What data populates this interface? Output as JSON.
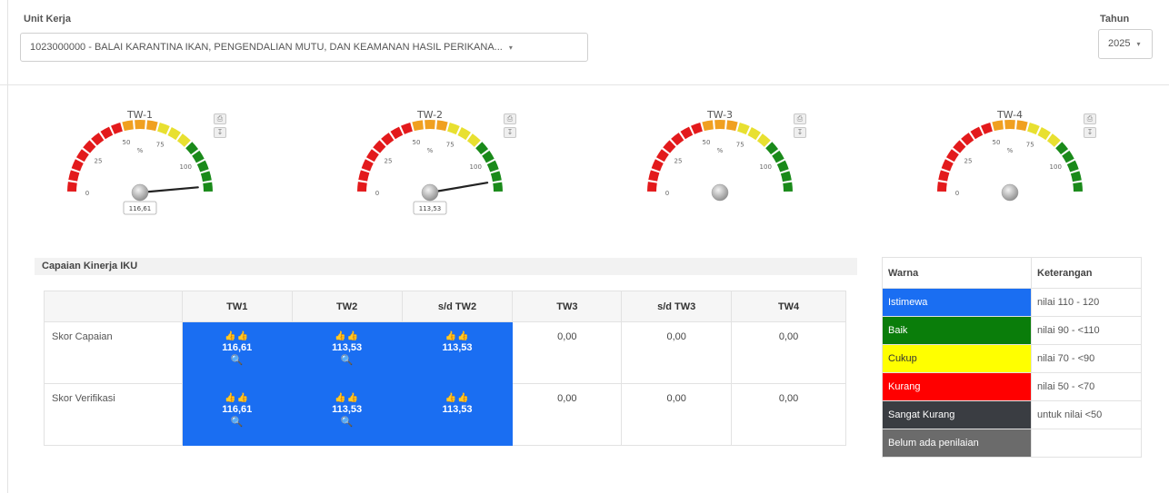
{
  "filters": {
    "unit_label": "Unit Kerja",
    "unit_value": "1023000000 - BALAI KARANTINA IKAN, PENGENDALIAN MUTU, DAN KEAMANAN HASIL PERIKANA...",
    "year_label": "Tahun",
    "year_value": "2025"
  },
  "gauges": [
    {
      "title": "TW-1",
      "value": 116.61,
      "value_label": "116,61",
      "show_needle": true
    },
    {
      "title": "TW-2",
      "value": 113.53,
      "value_label": "113,53",
      "show_needle": true
    },
    {
      "title": "TW-3",
      "value": null,
      "value_label": "",
      "show_needle": false
    },
    {
      "title": "TW-4",
      "value": null,
      "value_label": "",
      "show_needle": false
    }
  ],
  "gauge_scale": {
    "ticks": [
      "0",
      "25",
      "50",
      "75",
      "100"
    ],
    "unit": "%",
    "min": 0,
    "max": 120,
    "bands": [
      {
        "from": 0,
        "to": 50,
        "color": "#e31a1c"
      },
      {
        "from": 50,
        "to": 70,
        "color": "#f0a020"
      },
      {
        "from": 70,
        "to": 90,
        "color": "#e8e030"
      },
      {
        "from": 90,
        "to": 120,
        "color": "#1a8a1a"
      }
    ]
  },
  "iku": {
    "title": "Capaian Kinerja IKU",
    "columns": [
      "",
      "TW1",
      "TW2",
      "s/d TW2",
      "TW3",
      "s/d TW3",
      "TW4"
    ],
    "rows": [
      {
        "label": "Skor Capaian",
        "tw1": "116,61",
        "tw2": "113,53",
        "sd_tw2": "113,53",
        "tw3": "0,00",
        "sd_tw3": "0,00",
        "tw4": "0,00"
      },
      {
        "label": "Skor Verifikasi",
        "tw1": "116,61",
        "tw2": "113,53",
        "sd_tw2": "113,53",
        "tw3": "0,00",
        "sd_tw3": "0,00",
        "tw4": "0,00"
      }
    ]
  },
  "legend": {
    "header_color": "Warna",
    "header_desc": "Keterangan",
    "items": [
      {
        "name": "Istimewa",
        "desc": "nilai 110 - 120",
        "color": "#1a6ef2"
      },
      {
        "name": "Baik",
        "desc": "nilai 90 - <110",
        "color": "#0a7d0a"
      },
      {
        "name": "Cukup",
        "desc": "nilai 70 - <90",
        "color": "#ffff00"
      },
      {
        "name": "Kurang",
        "desc": "nilai 50 - <70",
        "color": "#ff0000"
      },
      {
        "name": "Sangat Kurang",
        "desc": "untuk nilai <50",
        "color": "#3a3d42"
      },
      {
        "name": "Belum ada penilaian",
        "desc": "",
        "color": "#6b6b6b"
      }
    ]
  }
}
